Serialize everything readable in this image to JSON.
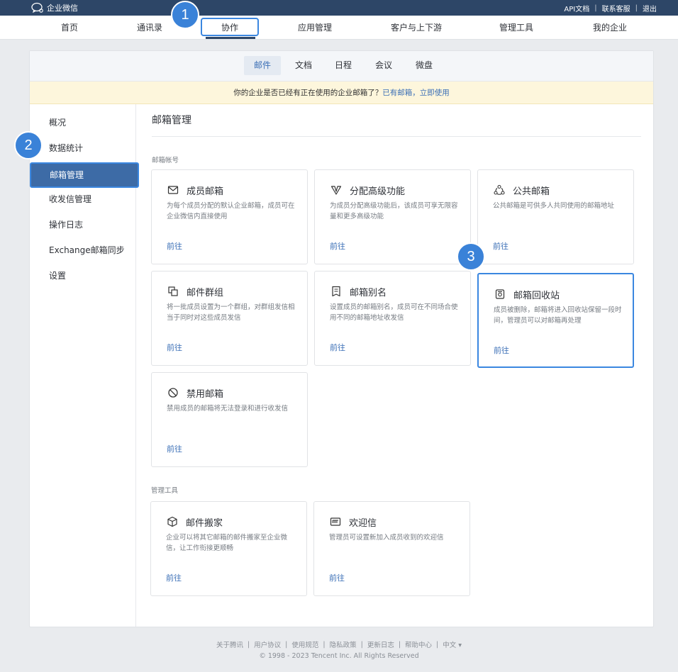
{
  "app": {
    "logo_text": "企业微信"
  },
  "toplinks": [
    "API文档",
    "联系客服",
    "退出"
  ],
  "mainnav": [
    {
      "label": "首页"
    },
    {
      "label": "通讯录"
    },
    {
      "label": "协作"
    },
    {
      "label": "应用管理"
    },
    {
      "label": "客户与上下游"
    },
    {
      "label": "管理工具"
    },
    {
      "label": "我的企业"
    }
  ],
  "subnav": [
    {
      "label": "邮件"
    },
    {
      "label": "文档"
    },
    {
      "label": "日程"
    },
    {
      "label": "会议"
    },
    {
      "label": "微盘"
    }
  ],
  "notice": {
    "text": "你的企业是否已经有正在使用的企业邮箱了？",
    "link": "已有邮箱，立即使用"
  },
  "sidebar": [
    {
      "label": "概况"
    },
    {
      "label": "数据统计"
    },
    {
      "label": "邮箱管理"
    },
    {
      "label": "收发信管理"
    },
    {
      "label": "操作日志"
    },
    {
      "label": "Exchange邮箱同步"
    },
    {
      "label": "设置"
    }
  ],
  "content": {
    "title": "邮箱管理",
    "section1": "邮箱帐号",
    "section2": "管理工具",
    "go_label": "前往",
    "tiles": [
      {
        "title": "成员邮箱",
        "desc": "为每个成员分配的默认企业邮箱，成员可在企业微信内直接使用",
        "icon": "envelope-icon"
      },
      {
        "title": "分配高级功能",
        "desc": "为成员分配高级功能后，该成员可享无限容量和更多高级功能",
        "icon": "v-badge-icon"
      },
      {
        "title": "公共邮箱",
        "desc": "公共邮箱是可供多人共同使用的邮箱地址",
        "icon": "group-icon"
      },
      {
        "title": "邮件群组",
        "desc": "将一批成员设置为一个群组，对群组发信相当于同时对这些成员发信",
        "icon": "copy-group-icon"
      },
      {
        "title": "邮箱别名",
        "desc": "设置成员的邮箱别名，成员可在不同场合使用不同的邮箱地址收发信",
        "icon": "alias-icon"
      },
      {
        "title": "邮箱回收站",
        "desc": "成员被删除，邮箱将进入回收站保留一段时间，管理员可以对邮箱再处理",
        "icon": "recycle-bin-icon"
      },
      {
        "title": "禁用邮箱",
        "desc": "禁用成员的邮箱将无法登录和进行收发信",
        "icon": "ban-icon"
      },
      {
        "title": "邮件搬家",
        "desc": "企业可以将其它邮箱的邮件搬家至企业微信，让工作衔接更顺畅",
        "icon": "box-icon"
      },
      {
        "title": "欢迎信",
        "desc": "管理员可设置新加入成员收到的欢迎信",
        "icon": "welcome-letter-icon"
      }
    ]
  },
  "badges": [
    "1",
    "2",
    "3"
  ],
  "footer": {
    "links": [
      "关于腾讯",
      "用户协议",
      "使用规范",
      "隐私政策",
      "更新日志",
      "帮助中心",
      "中文 ▾"
    ],
    "copyright": "© 1998 - 2023 Tencent Inc. All Rights Reserved"
  }
}
